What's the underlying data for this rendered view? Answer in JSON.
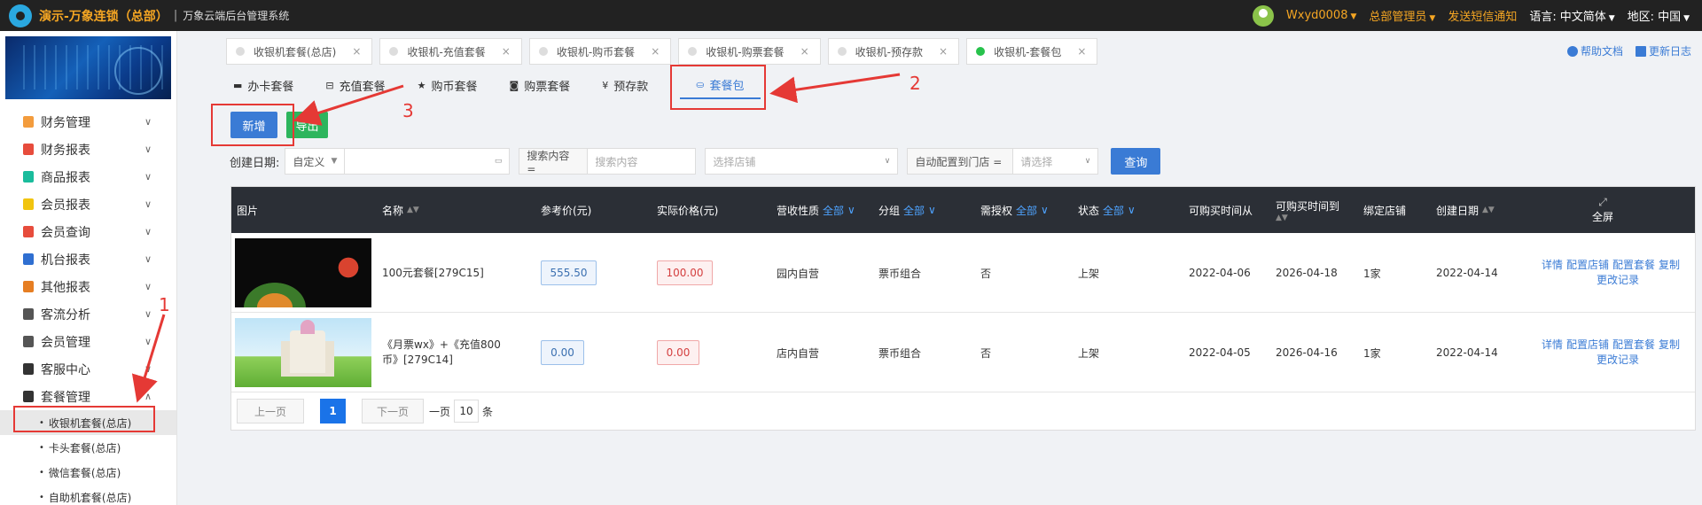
{
  "topbar": {
    "brand": "演示-万象连锁（总部）",
    "separator": "|",
    "system_name": "万象云端后台管理系统",
    "user": "Wxyd0008",
    "role": "总部管理员",
    "sms": "发送短信通知",
    "lang_label": "语言:",
    "lang_value": "中文简体",
    "region_label": "地区:",
    "region_value": "中国"
  },
  "sidebar": {
    "items": [
      {
        "label": "财务管理",
        "color": "#f39c3d"
      },
      {
        "label": "财务报表",
        "color": "#e74c3c"
      },
      {
        "label": "商品报表",
        "color": "#1abc9c"
      },
      {
        "label": "会员报表",
        "color": "#f1c40f"
      },
      {
        "label": "会员查询",
        "color": "#e74c3c"
      },
      {
        "label": "机台报表",
        "color": "#2f6fd1"
      },
      {
        "label": "其他报表",
        "color": "#e67e22"
      },
      {
        "label": "客流分析",
        "color": "#555555"
      },
      {
        "label": "会员管理",
        "color": "#555555"
      },
      {
        "label": "客服中心",
        "color": "#333333"
      },
      {
        "label": "套餐管理",
        "color": "#333333"
      }
    ],
    "sub_items": [
      "收银机套餐(总店)",
      "卡头套餐(总店)",
      "微信套餐(总店)",
      "自助机套餐(总店)"
    ]
  },
  "tabs": [
    {
      "label": "收银机套餐(总店)",
      "active": false
    },
    {
      "label": "收银机-充值套餐",
      "active": false
    },
    {
      "label": "收银机-购币套餐",
      "active": false
    },
    {
      "label": "收银机-购票套餐",
      "active": false
    },
    {
      "label": "收银机-预存款",
      "active": false
    },
    {
      "label": "收银机-套餐包",
      "active": true
    }
  ],
  "help": {
    "docs": "帮助文档",
    "changelog": "更新日志"
  },
  "subtabs": [
    {
      "icon": "card-icon",
      "glyph": "▬",
      "label": "办卡套餐"
    },
    {
      "icon": "recharge-icon",
      "glyph": "⊟",
      "label": "充值套餐"
    },
    {
      "icon": "star-icon",
      "glyph": "★",
      "label": "购币套餐"
    },
    {
      "icon": "ticket-icon",
      "glyph": "◙",
      "label": "购票套餐"
    },
    {
      "icon": "yen-icon",
      "glyph": "¥",
      "label": "预存款"
    },
    {
      "icon": "basket-icon",
      "glyph": "⛀",
      "label": "套餐包"
    }
  ],
  "buttons": {
    "add": "新增",
    "export": "导出",
    "query": "查询"
  },
  "filters": {
    "date_label": "创建日期:",
    "date_mode": "自定义",
    "search_label": "搜索内容 =",
    "search_placeholder": "搜索内容",
    "store_placeholder": "选择店铺",
    "auto_label": "自动配置到门店 =",
    "auto_placeholder": "请选择"
  },
  "table": {
    "headers": {
      "image": "图片",
      "name": "名称",
      "ref_price": "参考价(元)",
      "actual_price": "实际价格(元)",
      "revenue_type": "营收性质",
      "group": "分组",
      "auth": "需授权",
      "status": "状态",
      "from": "可购买时间从",
      "to": "可购买时间到",
      "stores": "绑定店铺",
      "created": "创建日期",
      "fullscreen": "全屏",
      "all": "全部"
    },
    "rows": [
      {
        "name": "100元套餐[279C15]",
        "ref_price": "555.50",
        "actual_price": "100.00",
        "revenue_type": "园内自营",
        "group": "票币组合",
        "auth": "否",
        "status": "上架",
        "from": "2022-04-06",
        "to": "2026-04-18",
        "stores": "1家",
        "created": "2022-04-14"
      },
      {
        "name": "《月票wx》+《充值800币》[279C14]",
        "ref_price": "0.00",
        "actual_price": "0.00",
        "revenue_type": "店内自营",
        "group": "票币组合",
        "auth": "否",
        "status": "上架",
        "from": "2022-04-05",
        "to": "2026-04-16",
        "stores": "1家",
        "created": "2022-04-14"
      }
    ],
    "ops": [
      "详情",
      "配置店铺",
      "配置套餐",
      "复制",
      "更改记录"
    ]
  },
  "pager": {
    "prev": "上一页",
    "current": "1",
    "next": "下一页",
    "per_page_label": "一页",
    "per_page": "10",
    "unit": "条"
  },
  "annotations": {
    "one": "1",
    "two": "2",
    "three": "3"
  }
}
